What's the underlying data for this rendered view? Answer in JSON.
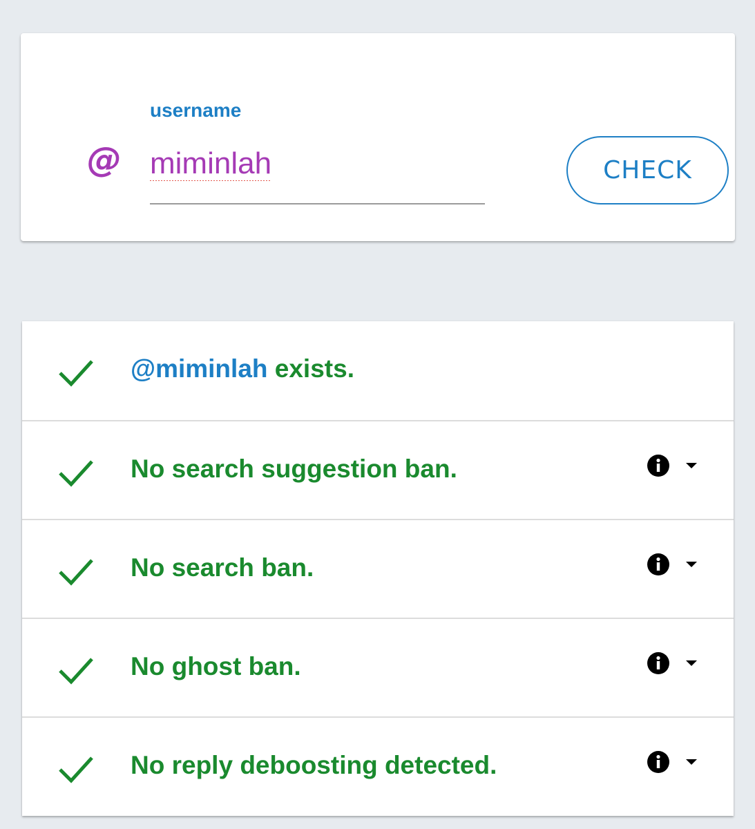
{
  "search": {
    "label": "username",
    "at_symbol": "@",
    "value": "miminlah",
    "button_label": "CHECK"
  },
  "results": [
    {
      "prefix": "@miminlah",
      "text": " exists.",
      "status": "pass",
      "has_info": false
    },
    {
      "prefix": "",
      "text": "No search suggestion ban.",
      "status": "pass",
      "has_info": true
    },
    {
      "prefix": "",
      "text": "No search ban.",
      "status": "pass",
      "has_info": true
    },
    {
      "prefix": "",
      "text": "No ghost ban.",
      "status": "pass",
      "has_info": true
    },
    {
      "prefix": "",
      "text": "No reply deboosting detected.",
      "status": "pass",
      "has_info": true
    }
  ],
  "icons": {
    "status_pass": "check-icon",
    "info": "info-icon",
    "expand": "dropdown-arrow-icon"
  },
  "colors": {
    "background": "#e7ebef",
    "accent_blue": "#1d7fc5",
    "accent_purple": "#a53ab5",
    "success_green": "#1a8a2e"
  }
}
